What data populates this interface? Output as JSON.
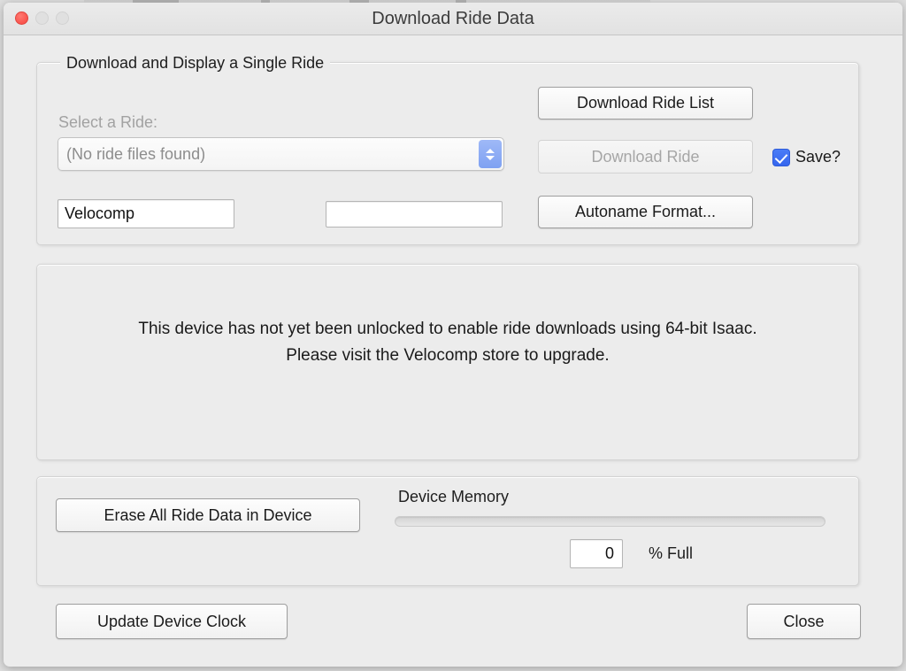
{
  "window": {
    "title": "Download Ride Data",
    "traffic_lights": [
      "close-button",
      "minimize-button",
      "zoom-button"
    ]
  },
  "single_ride_group": {
    "legend": "Download and Display a Single Ride",
    "select_ride_label": "Select a Ride:",
    "ride_popup": {
      "selected": "(No ride files found)",
      "options": [
        "(No ride files found)"
      ],
      "enabled": false
    },
    "name_prefix_field": {
      "value": "Velocomp",
      "placeholder": ""
    },
    "name_suffix_field": {
      "value": "",
      "placeholder": ""
    },
    "download_ride_list_button": "Download Ride List",
    "download_ride_button": {
      "label": "Download Ride",
      "enabled": false
    },
    "save_checkbox": {
      "label": "Save?",
      "checked": true
    },
    "autoname_format_button": "Autoname Format..."
  },
  "message_panel": {
    "line1": "This device has not yet been unlocked to enable ride downloads using 64-bit Isaac.",
    "line2": "Please visit the Velocomp store to upgrade."
  },
  "device_memory_group": {
    "erase_button": "Erase All Ride Data in Device",
    "memory_label": "Device Memory",
    "percent_value": "0",
    "percent_label": "% Full",
    "progress_percent": 0
  },
  "footer": {
    "update_clock_button": "Update Device Clock",
    "close_button": "Close"
  },
  "colors": {
    "accent_blue": "#3566ee",
    "popup_arrow_blue": "#7fa1f2",
    "close_light_red": "#f9534c",
    "window_background": "#ececec"
  }
}
